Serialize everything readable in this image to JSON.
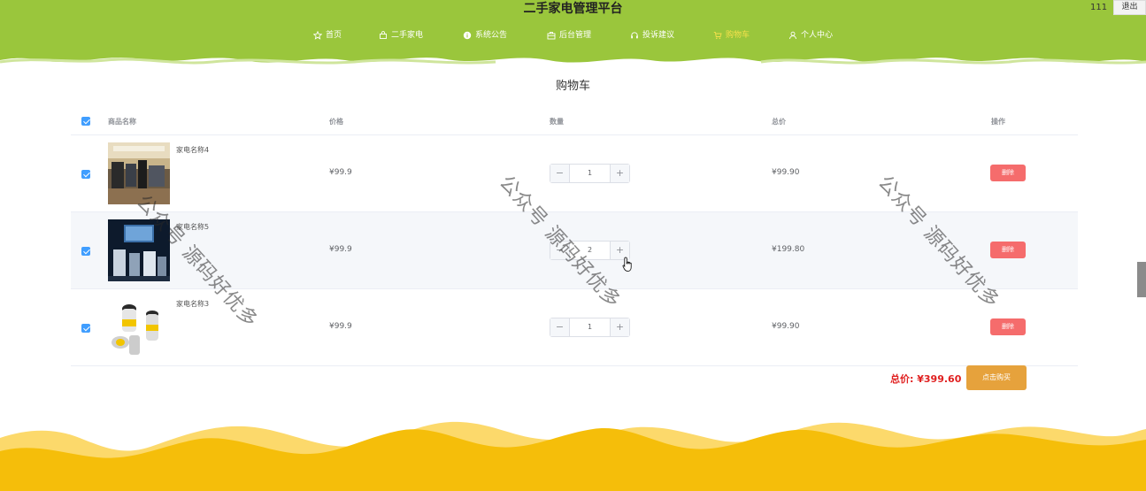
{
  "header": {
    "site_title": "二手家电管理平台",
    "user_name": "111",
    "logout_label": "退出",
    "nav": [
      {
        "label": "首页",
        "icon": "star-icon"
      },
      {
        "label": "二手家电",
        "icon": "bag-icon"
      },
      {
        "label": "系统公告",
        "icon": "info-icon"
      },
      {
        "label": "后台管理",
        "icon": "briefcase-icon"
      },
      {
        "label": "投诉建议",
        "icon": "headset-icon"
      },
      {
        "label": "购物车",
        "icon": "cart-icon",
        "active": true
      },
      {
        "label": "个人中心",
        "icon": "user-icon"
      }
    ],
    "colors": {
      "header_bg": "#9ac63c",
      "active_nav": "#f5e04b"
    }
  },
  "page_title": "购物车",
  "table": {
    "columns": [
      "商品名称",
      "价格",
      "数量",
      "总价",
      "操作"
    ],
    "rows": [
      {
        "name": "家电名称4",
        "price": "¥99.9",
        "quantity": "1",
        "total": "¥99.90",
        "action": "删除",
        "checked": true
      },
      {
        "name": "家电名称5",
        "price": "¥99.9",
        "quantity": "2",
        "total": "¥199.80",
        "action": "删除",
        "checked": true
      },
      {
        "name": "家电名称3",
        "price": "¥99.9",
        "quantity": "1",
        "total": "¥99.90",
        "action": "删除",
        "checked": true
      }
    ]
  },
  "summary": {
    "label": "总价:",
    "amount": "¥399.60",
    "buy_label": "点击购买"
  },
  "watermark": "公众号 源码好优多",
  "colors": {
    "footer_wave": "#f5be0a",
    "delete": "#f56c6c",
    "buy": "#e6a23c",
    "checkbox": "#409eff"
  }
}
